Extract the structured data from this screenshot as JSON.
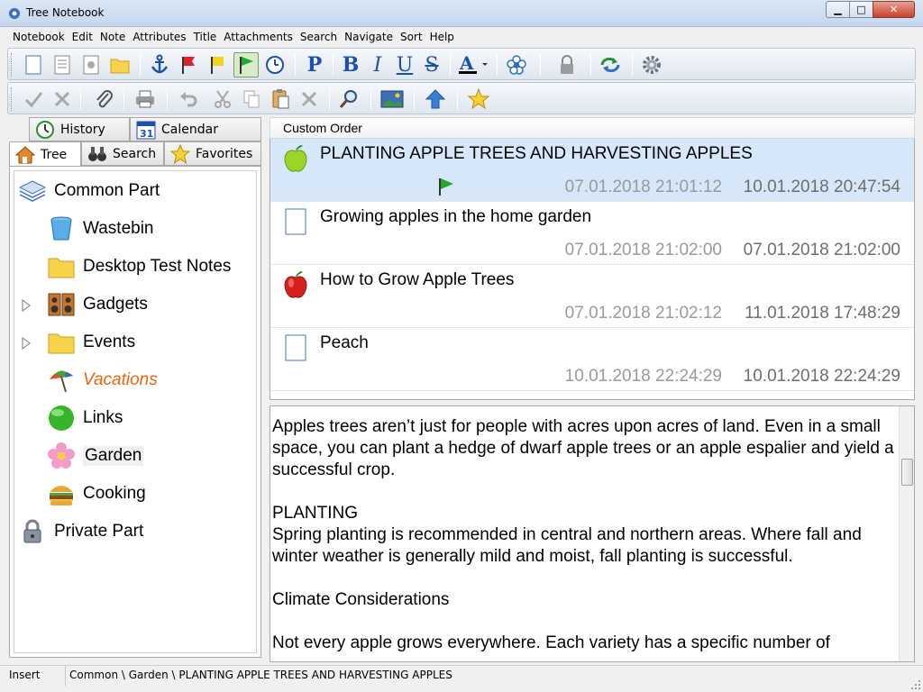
{
  "window": {
    "title": "Tree Notebook"
  },
  "menu": [
    "Notebook",
    "Edit",
    "Note",
    "Attributes",
    "Title",
    "Attachments",
    "Search",
    "Navigate",
    "Sort",
    "Help"
  ],
  "left_tabs": {
    "history": "History",
    "calendar": "Calendar",
    "tree": "Tree",
    "search": "Search",
    "favorites": "Favorites"
  },
  "tree": {
    "root_common": "Common Part",
    "items": [
      "Wastebin",
      "Desktop Test Notes",
      "Gadgets",
      "Events",
      "Vacations",
      "Links",
      "Garden",
      "Cooking"
    ],
    "root_private": "Private Part"
  },
  "notes_header": "Custom Order",
  "notes": [
    {
      "title": "PLANTING APPLE TREES AND HARVESTING APPLES",
      "created": "07.01.2018 21:01:12",
      "modified": "10.01.2018 20:47:54"
    },
    {
      "title": "Growing apples in the home garden",
      "created": "07.01.2018 21:02:00",
      "modified": "07.01.2018 21:02:00"
    },
    {
      "title": "How to Grow Apple Trees",
      "created": "07.01.2018 21:02:12",
      "modified": "11.01.2018 17:48:29"
    },
    {
      "title": "Peach",
      "created": "10.01.2018 22:24:29",
      "modified": "10.01.2018 22:24:29"
    }
  ],
  "editor": {
    "p1": "Apples trees aren’t just for people with acres upon acres of land. Even in a small space, you can plant a hedge of dwarf apple trees or an apple espalier and yield a successful crop.",
    "p2_heading": "PLANTING",
    "p2_body": "Spring planting is recommended in central and northern areas. Where fall and winter weather is generally mild and moist, fall planting is successful.",
    "p3_heading": "Climate Considerations",
    "p4": "Not every apple grows everywhere. Each variety has a specific number of"
  },
  "status": {
    "mode": "Insert",
    "path": "Common \\ Garden \\ PLANTING APPLE TREES AND HARVESTING APPLES"
  },
  "colors": {
    "selection": "#d5e7f9",
    "vacations": "#e8650c",
    "toolbar_blue": "#1c4fb0"
  }
}
